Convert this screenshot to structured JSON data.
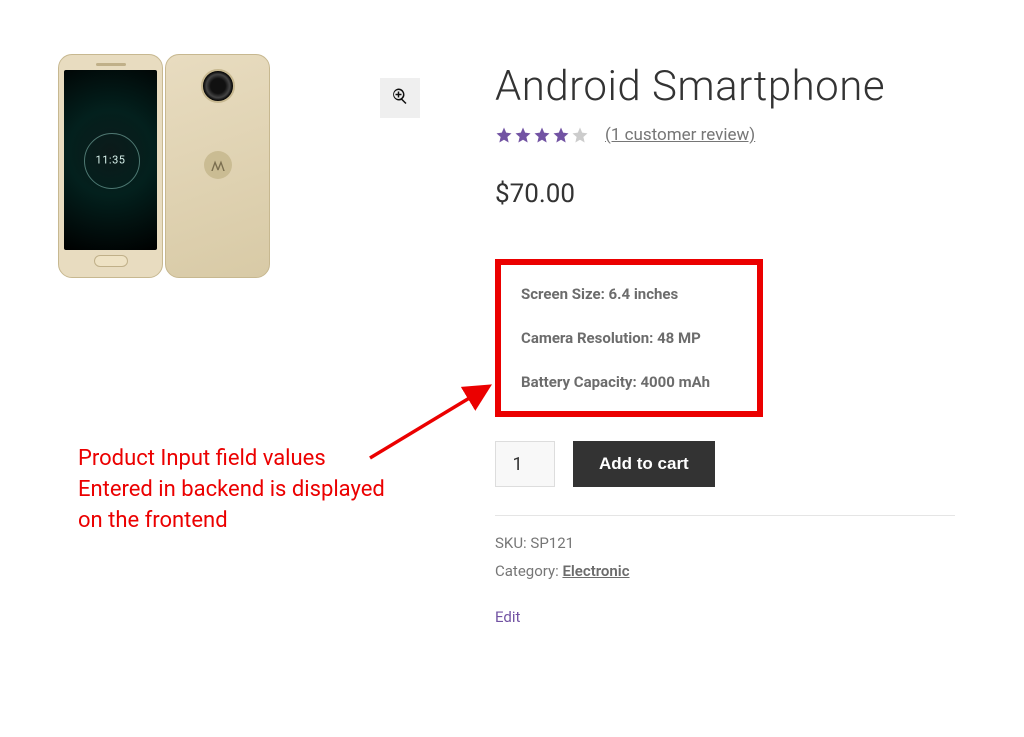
{
  "product": {
    "title": "Android Smartphone",
    "rating": 4,
    "reviews_link": "(1 customer review)",
    "currency": "$",
    "price": "70.00",
    "quantity_value": "1",
    "add_to_cart_label": "Add to cart",
    "sku_label": "SKU:",
    "sku_value": "SP121",
    "category_label": "Category:",
    "category_value": "Electronic",
    "edit_label": "Edit"
  },
  "specs": {
    "screen_label": "Screen Size:",
    "screen_value": "6.4 inches",
    "camera_label": "Camera Resolution:",
    "camera_value": "48 MP",
    "battery_label": "Battery Capacity:",
    "battery_value": "4000 mAh"
  },
  "annotation": {
    "line1": "Product Input field values",
    "line2": "Entered in backend is displayed",
    "line3": "on the frontend"
  }
}
